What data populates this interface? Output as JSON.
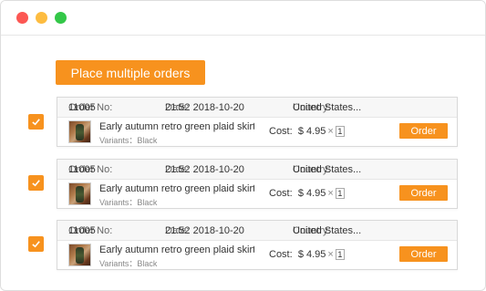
{
  "window": {
    "controls": [
      "close",
      "minimize",
      "maximize"
    ]
  },
  "toolbar": {
    "bulk_order_label": "Place multiple orders"
  },
  "colors": {
    "accent": "#f7921e"
  },
  "labels": {
    "order_no": "Order No:",
    "date": "Date:",
    "country": "Country:",
    "variants": "Variants：",
    "cost": "Cost:",
    "times": "×",
    "order_button": "Order"
  },
  "orders": [
    {
      "checked": true,
      "order_no": "11005",
      "date": "21:52 2018-10-20",
      "country": "United States...",
      "title": "Early autumn retro green plaid skirt...",
      "variant": "Black",
      "price": "$ 4.95",
      "qty": "1"
    },
    {
      "checked": true,
      "order_no": "11005",
      "date": "21:52 2018-10-20",
      "country": "United States...",
      "title": "Early autumn retro green plaid skirt...",
      "variant": "Black",
      "price": "$ 4.95",
      "qty": "1"
    },
    {
      "checked": true,
      "order_no": "11005",
      "date": "21:52 2018-10-20",
      "country": "United States...",
      "title": "Early autumn retro green plaid skirt...",
      "variant": "Black",
      "price": "$ 4.95",
      "qty": "1"
    }
  ]
}
